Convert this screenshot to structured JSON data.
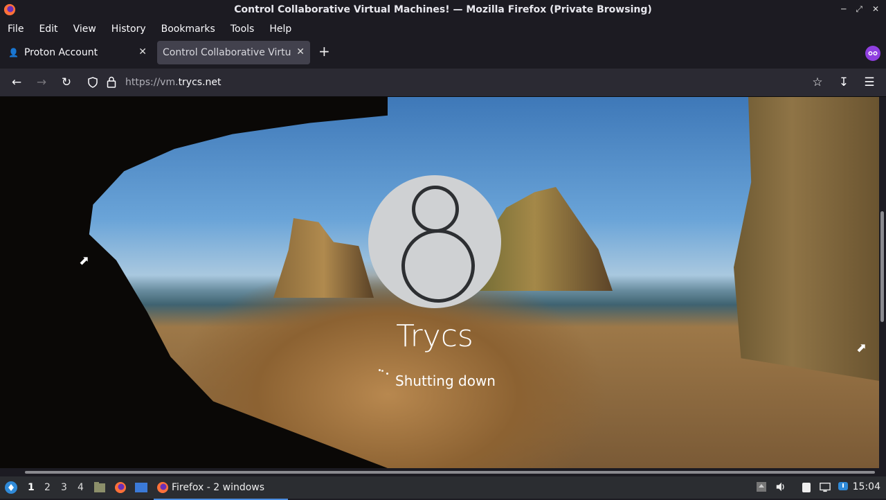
{
  "window": {
    "title": "Control Collaborative Virtual Machines! — Mozilla Firefox (Private Browsing)"
  },
  "menu": [
    "File",
    "Edit",
    "View",
    "History",
    "Bookmarks",
    "Tools",
    "Help"
  ],
  "tabs": [
    {
      "label": "Proton Account",
      "active": false
    },
    {
      "label": "Control Collaborative Virtual Machines!",
      "active": true
    }
  ],
  "url": {
    "scheme": "https://vm.",
    "host": "trycs.net"
  },
  "vm": {
    "user_name": "Trycs",
    "status": "Shutting down"
  },
  "taskbar": {
    "workspaces": [
      "1",
      "2",
      "3",
      "4"
    ],
    "active_app": "Firefox - 2 windows",
    "clock": "15:04"
  },
  "colors": {
    "accent": "#4a8ce0",
    "private_badge": "#8f3fe0"
  }
}
